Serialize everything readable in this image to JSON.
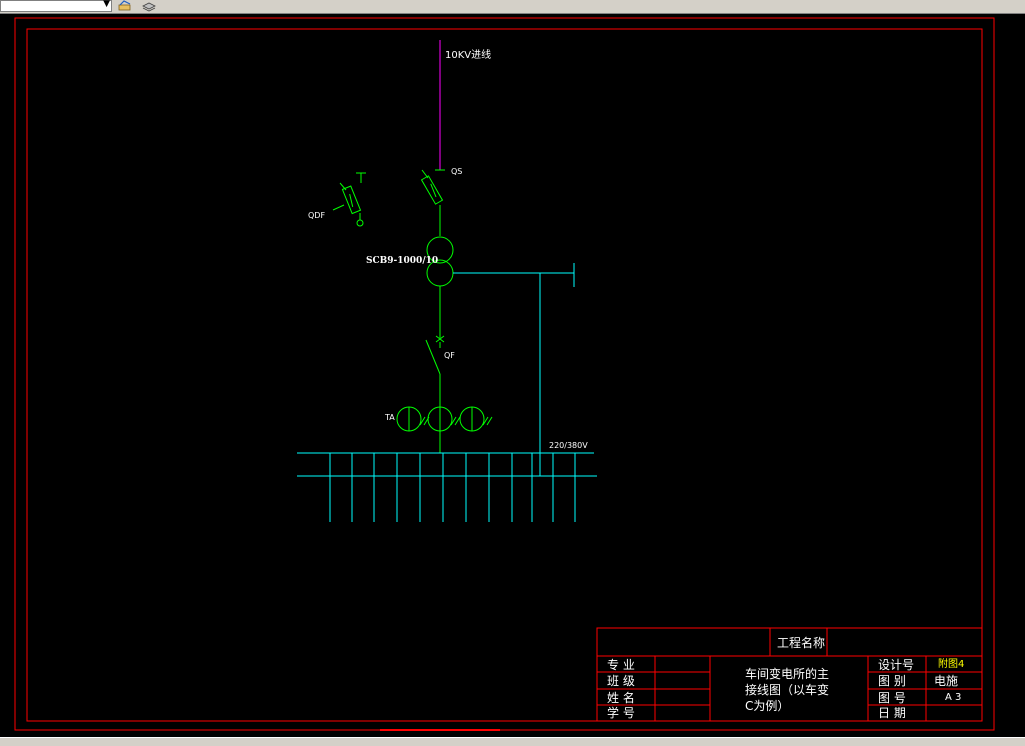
{
  "toolbar": {
    "layer_combo_value": "",
    "buttons": [
      {
        "icon": "layer-states-icon"
      },
      {
        "icon": "layer-stack-icon"
      }
    ]
  },
  "drawing": {
    "labels": {
      "incoming": "10KV进线",
      "qs": "QS",
      "qdf": "QDF",
      "transformer": "SCB9-1000/10",
      "qf": "QF",
      "ta": "TA",
      "lv_bus": "220/380V"
    },
    "colors": {
      "frame": "#ff0000",
      "incoming_line": "#ff00ff",
      "equipment": "#00ff00",
      "bus": "#00ffff",
      "label": "#ffffff",
      "titleblock_value": "#ffff00"
    },
    "title_block": {
      "project_name": "工程名称",
      "major": "专  业",
      "class": "班  级",
      "name": "姓  名",
      "student_id": "学  号",
      "drawing_title_line1": "车间变电所的主",
      "drawing_title_line2": "接线图（以车变",
      "drawing_title_line3": "C为例）",
      "design_no_label": "设计号",
      "design_no_value": "附图4",
      "category_label": "图  别",
      "category_value": "电施",
      "drawing_no_label": "图  号",
      "drawing_no_value": "A 3",
      "date_label": "日  期"
    }
  }
}
